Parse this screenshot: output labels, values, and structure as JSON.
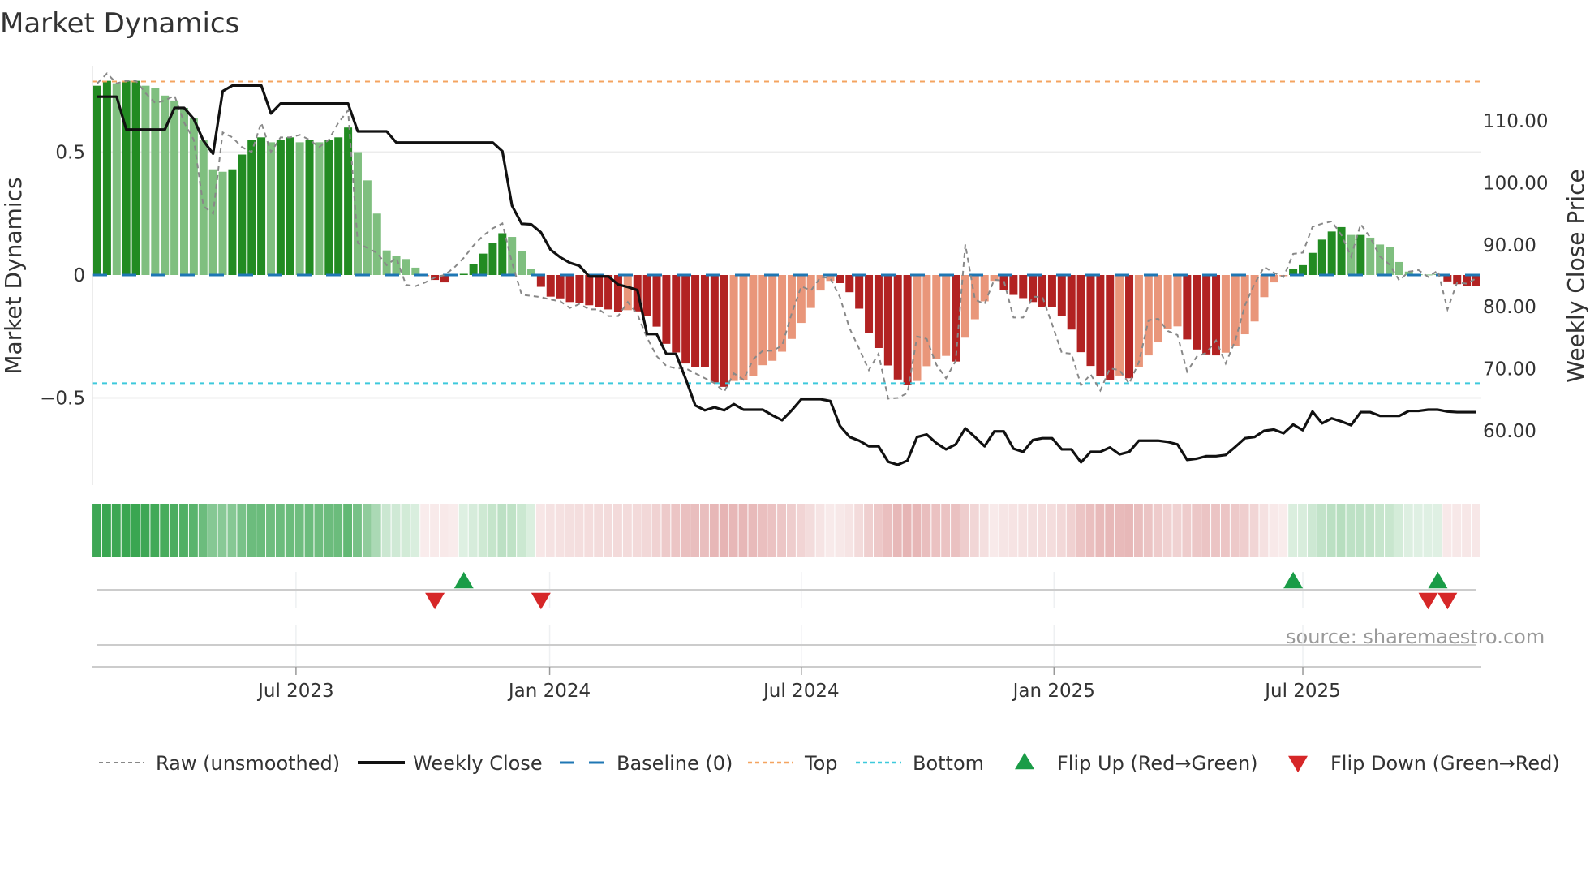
{
  "chart_data": {
    "type": "bar",
    "title": "Market Dynamics",
    "ylabel": "Market Dynamics",
    "ylabel_right": "Weekly Close Price",
    "ylim": [
      -0.82,
      0.86
    ],
    "ylim_right": [
      49.4,
      121
    ],
    "yticks": [
      {
        "v": 0.5,
        "label": "0.5"
      },
      {
        "v": 0,
        "label": "0"
      },
      {
        "v": -0.5,
        "label": "−0.5"
      }
    ],
    "yticks_right": [
      {
        "v": 110,
        "label": "110.00"
      },
      {
        "v": 100,
        "label": "100.00"
      },
      {
        "v": 90,
        "label": "90.00"
      },
      {
        "v": 80,
        "label": "80.00"
      },
      {
        "v": 70,
        "label": "70.00"
      },
      {
        "v": 60,
        "label": "60.00"
      }
    ],
    "xticks": [
      {
        "week": 20.6,
        "label": "Jul 2023"
      },
      {
        "week": 46.9,
        "label": "Jan 2024"
      },
      {
        "week": 73.0,
        "label": "Jul 2024"
      },
      {
        "week": 99.2,
        "label": "Jan 2025"
      },
      {
        "week": 125.0,
        "label": "Jul 2025"
      }
    ],
    "weeks": 144,
    "top_level": 0.787,
    "bottom_level": -0.44,
    "baseline": 0,
    "grid": true,
    "legend_position": "bottom",
    "colors": {
      "green_dark": "#228b22",
      "green_light": "#7fbf7f",
      "red_dark": "#b22222",
      "red_light": "#e9967a",
      "raw": "#888888",
      "close": "#111111",
      "baseline": "#1f77b4",
      "top": "#f4a460",
      "bottom": "#3ec9dc",
      "flip_up": "#1a9c47",
      "flip_down": "#d62728"
    },
    "dynamics": [
      0.77,
      0.79,
      0.78,
      0.79,
      0.79,
      0.77,
      0.76,
      0.73,
      0.71,
      0.68,
      0.64,
      0.55,
      0.43,
      0.42,
      0.43,
      0.49,
      0.55,
      0.56,
      0.54,
      0.55,
      0.56,
      0.54,
      0.55,
      0.54,
      0.55,
      0.56,
      0.6,
      0.5,
      0.385,
      0.25,
      0.1,
      0.076,
      0.065,
      0.03,
      -0.005,
      -0.02,
      -0.03,
      -0.005,
      0.005,
      0.046,
      0.087,
      0.13,
      0.17,
      0.155,
      0.096,
      0.024,
      -0.048,
      -0.088,
      -0.095,
      -0.11,
      -0.115,
      -0.123,
      -0.13,
      -0.14,
      -0.15,
      -0.143,
      -0.148,
      -0.167,
      -0.21,
      -0.28,
      -0.315,
      -0.36,
      -0.375,
      -0.376,
      -0.437,
      -0.455,
      -0.431,
      -0.429,
      -0.41,
      -0.367,
      -0.349,
      -0.312,
      -0.26,
      -0.195,
      -0.134,
      -0.063,
      -0.024,
      -0.033,
      -0.07,
      -0.137,
      -0.236,
      -0.297,
      -0.368,
      -0.425,
      -0.447,
      -0.431,
      -0.371,
      -0.343,
      -0.329,
      -0.352,
      -0.255,
      -0.18,
      -0.107,
      -0.024,
      -0.06,
      -0.081,
      -0.094,
      -0.11,
      -0.129,
      -0.129,
      -0.165,
      -0.222,
      -0.314,
      -0.37,
      -0.411,
      -0.426,
      -0.409,
      -0.42,
      -0.373,
      -0.327,
      -0.274,
      -0.219,
      -0.209,
      -0.262,
      -0.303,
      -0.323,
      -0.327,
      -0.316,
      -0.29,
      -0.241,
      -0.189,
      -0.09,
      -0.03,
      -0.005,
      0.025,
      0.04,
      0.09,
      0.144,
      0.177,
      0.195,
      0.163,
      0.163,
      0.152,
      0.124,
      0.113,
      0.053,
      0.014,
      0.003,
      0.002,
      0.004,
      -0.026,
      -0.037,
      -0.046,
      -0.046
    ],
    "shade": "DDLDDLLLLLLLLLDDDDLDDLDLDDDLLLLLLLLDDLDDDDDLLLDDDDDDDDDLDDDDDDDDDDLLLLLLLLLLLDDDDDDDDLLLLDLLLLDDDDDDDDDDDDLDLLLLLDDDDLLLLLLLDDDDDDLDLLLLLLLLDDDD",
    "raw": [
      0.78,
      0.82,
      0.78,
      0.79,
      0.79,
      0.74,
      0.7,
      0.71,
      0.73,
      0.62,
      0.55,
      0.28,
      0.25,
      0.58,
      0.56,
      0.52,
      0.5,
      0.62,
      0.5,
      0.56,
      0.56,
      0.57,
      0.55,
      0.52,
      0.55,
      0.62,
      0.67,
      0.13,
      0.11,
      0.09,
      0.04,
      0.07,
      -0.04,
      -0.045,
      -0.03,
      -0.01,
      0,
      0.03,
      0.07,
      0.12,
      0.16,
      0.19,
      0.21,
      0.05,
      -0.08,
      -0.085,
      -0.09,
      -0.1,
      -0.107,
      -0.134,
      -0.118,
      -0.14,
      -0.14,
      -0.167,
      -0.167,
      -0.11,
      -0.16,
      -0.255,
      -0.33,
      -0.37,
      -0.38,
      -0.38,
      -0.4,
      -0.42,
      -0.44,
      -0.475,
      -0.4,
      -0.426,
      -0.343,
      -0.308,
      -0.308,
      -0.288,
      -0.156,
      -0.046,
      -0.063,
      -0.008,
      -0.013,
      -0.09,
      -0.217,
      -0.3,
      -0.387,
      -0.32,
      -0.503,
      -0.5,
      -0.48,
      -0.25,
      -0.26,
      -0.365,
      -0.42,
      -0.35,
      0.124,
      -0.1,
      -0.118,
      -0.019,
      -0.024,
      -0.173,
      -0.173,
      -0.088,
      -0.09,
      -0.2,
      -0.316,
      -0.32,
      -0.448,
      -0.404,
      -0.47,
      -0.38,
      -0.387,
      -0.442,
      -0.354,
      -0.184,
      -0.178,
      -0.228,
      -0.244,
      -0.393,
      -0.332,
      -0.316,
      -0.266,
      -0.36,
      -0.266,
      -0.123,
      -0.035,
      0.033,
      0.009,
      -0.008,
      0.086,
      0.091,
      0.196,
      0.209,
      0.218,
      0.163,
      0.075,
      0.207,
      0.152,
      0.075,
      0.042,
      -0.022,
      0.014,
      0.02,
      -0.008,
      0.018,
      -0.14,
      -0.03,
      -0.035,
      -0.013
    ],
    "close": [
      113.9,
      113.9,
      113.9,
      108.6,
      108.6,
      108.6,
      108.6,
      108.6,
      112.1,
      112.1,
      110.3,
      106.8,
      104.7,
      114.8,
      115.7,
      115.7,
      115.7,
      115.7,
      111.2,
      112.8,
      112.8,
      112.8,
      112.8,
      112.8,
      112.8,
      112.8,
      112.8,
      108.3,
      108.3,
      108.3,
      108.3,
      106.5,
      106.5,
      106.5,
      106.5,
      106.5,
      106.5,
      106.5,
      106.5,
      106.5,
      106.5,
      106.5,
      105.1,
      96.3,
      93.4,
      93.3,
      92.0,
      89.2,
      88.0,
      87.1,
      86.6,
      84.9,
      84.9,
      84.9,
      83.6,
      83.2,
      82.7,
      75.6,
      75.6,
      72.4,
      72.4,
      68.4,
      64.1,
      63.3,
      63.8,
      63.3,
      64.3,
      63.4,
      63.4,
      63.4,
      62.5,
      61.7,
      63.3,
      65.1,
      65.1,
      65.1,
      64.8,
      60.8,
      59.0,
      58.4,
      57.5,
      57.5,
      55.0,
      54.5,
      55.2,
      59.0,
      59.4,
      58.0,
      57.0,
      57.8,
      60.4,
      59.0,
      57.5,
      59.9,
      59.9,
      57.1,
      56.6,
      58.5,
      58.8,
      58.8,
      57.0,
      57.0,
      54.9,
      56.6,
      56.6,
      57.3,
      56.2,
      56.6,
      58.4,
      58.4,
      58.4,
      58.2,
      57.8,
      55.3,
      55.5,
      55.9,
      55.9,
      56.1,
      57.4,
      58.8,
      59.0,
      60.0,
      60.2,
      59.6,
      61.0,
      60.1,
      63.1,
      61.2,
      62.0,
      61.5,
      60.9,
      63.0,
      63.0,
      62.4,
      62.4,
      62.4,
      63.2,
      63.2,
      63.4,
      63.4,
      63.1,
      63.0,
      63.0,
      63.0
    ],
    "flip_up_weeks": [
      38,
      124,
      139
    ],
    "flip_down_weeks": [
      35,
      46,
      138,
      140
    ],
    "legend": [
      {
        "key": "raw",
        "label": "Raw (unsmoothed)"
      },
      {
        "key": "close",
        "label": "Weekly Close"
      },
      {
        "key": "baseline",
        "label": "Baseline (0)"
      },
      {
        "key": "top",
        "label": "Top"
      },
      {
        "key": "bottom",
        "label": "Bottom"
      },
      {
        "key": "flip_up",
        "label": "Flip Up (Red→Green)"
      },
      {
        "key": "flip_down",
        "label": "Flip Down (Green→Red)"
      }
    ],
    "source": "source: sharemaestro.com"
  }
}
